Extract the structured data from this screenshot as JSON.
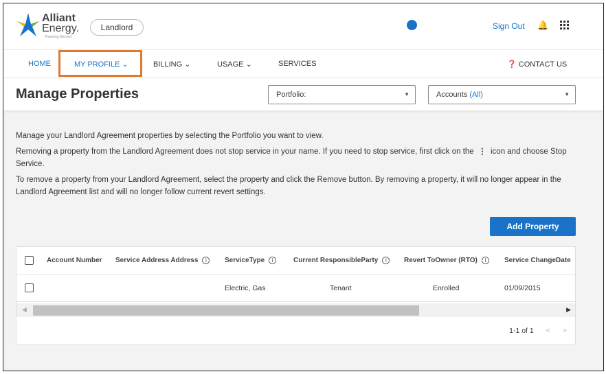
{
  "brand": {
    "name_line1": "Alliant",
    "name_line2": "Energy.",
    "tagline": "Powering Beyond"
  },
  "header": {
    "role_pill": "Landlord",
    "sign_out": "Sign Out",
    "icons": [
      "user-icon",
      "bell-icon",
      "apps-grid-icon"
    ]
  },
  "nav": {
    "items": [
      "HOME",
      "MY PROFILE",
      "BILLING",
      "USAGE",
      "SERVICES"
    ],
    "contact": "CONTACT US",
    "highlighted": "MY PROFILE",
    "highlight_color": "#e07a30"
  },
  "page": {
    "title": "Manage Properties",
    "portfolio_label": "Portfolio:",
    "accounts_label": "Accounts",
    "accounts_value": "(All)"
  },
  "body": {
    "p1": "Manage your Landlord Agreement properties by selecting the Portfolio you want to view.",
    "p2a": "Removing a property from the Landlord Agreement does not stop service in your name. If you need to stop service, first click on the",
    "p2b": "icon and choose Stop Service.",
    "p3": "To remove a property from your Landlord Agreement, select the property and click the Remove button. By removing a property, it will no longer appear in the Landlord Agreement list and will no longer follow current revert settings.",
    "add_button": "Add Property"
  },
  "table": {
    "columns": [
      "Account Number",
      "Service Address Address",
      "ServiceType",
      "Current ResponsibleParty",
      "Revert ToOwner (RTO)",
      "Service ChangeDate"
    ],
    "rows": [
      {
        "account": "",
        "address": "",
        "type": "Electric, Gas",
        "party": "Tenant",
        "rto": "Enrolled",
        "date": "01/09/2015"
      }
    ],
    "pagination": "1-1 of 1"
  },
  "colors": {
    "accent": "#1a73c8"
  }
}
